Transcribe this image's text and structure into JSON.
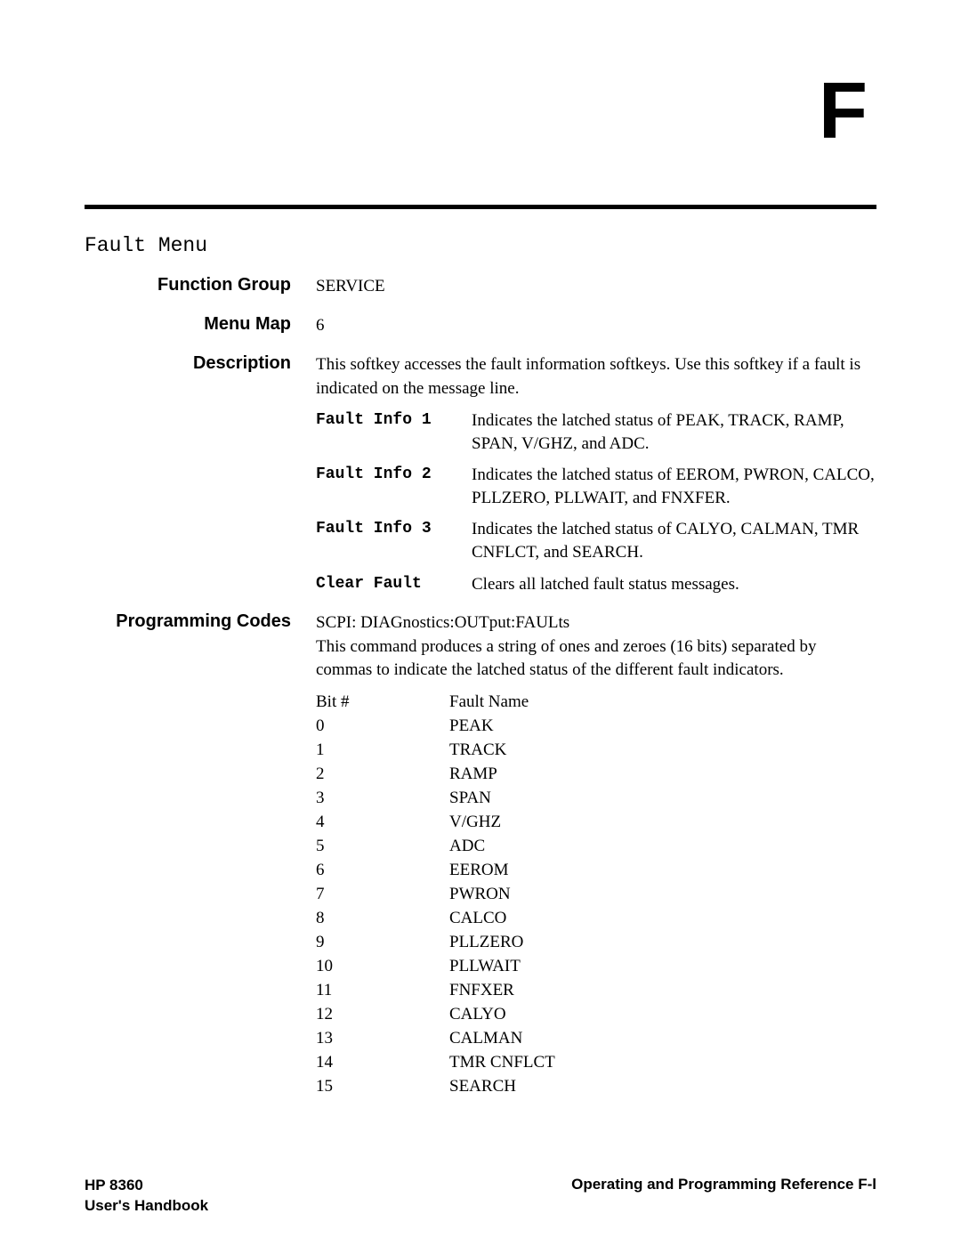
{
  "corner_letter": "F",
  "title": "Fault Menu",
  "rows": {
    "function_group": {
      "label": "Function Group",
      "value": "SERVICE"
    },
    "menu_map": {
      "label": "Menu Map",
      "value": "6"
    },
    "description": {
      "label": "Description",
      "intro": "This softkey accesses the fault information softkeys. Use this softkey if a fault is indicated on the message line.",
      "items": [
        {
          "term": "Fault Info 1",
          "def": "Indicates the latched status of PEAK, TRACK, RAMP, SPAN, V/GHZ, and ADC."
        },
        {
          "term": "Fault Info 2",
          "def": "Indicates the latched status of EEROM, PWRON, CALCO, PLLZERO, PLLWAIT, and FNXFER."
        },
        {
          "term": "Fault Info 3",
          "def": "Indicates the latched status of CALYO, CALMAN, TMR CNFLCT, and SEARCH."
        },
        {
          "term": "Clear Fault",
          "def": "Clears all latched fault status messages."
        }
      ]
    },
    "programming": {
      "label": "Programming Codes",
      "scpi": "SCPI: DIAGnostics:OUTput:FAULts",
      "body": "This command produces a string of ones and zeroes (16 bits) separated by commas to indicate the latched status of the different fault indicators.",
      "bit_header": {
        "bit": "Bit #",
        "name": "Fault Name"
      },
      "bits": [
        {
          "bit": "0",
          "name": "PEAK"
        },
        {
          "bit": "1",
          "name": "TRACK"
        },
        {
          "bit": "2",
          "name": "RAMP"
        },
        {
          "bit": "3",
          "name": "SPAN"
        },
        {
          "bit": "4",
          "name": "V/GHZ"
        },
        {
          "bit": "5",
          "name": "ADC"
        },
        {
          "bit": "6",
          "name": "EEROM"
        },
        {
          "bit": "7",
          "name": "PWRON"
        },
        {
          "bit": "8",
          "name": "CALCO"
        },
        {
          "bit": "9",
          "name": "PLLZERO"
        },
        {
          "bit": "10",
          "name": "PLLWAIT"
        },
        {
          "bit": "11",
          "name": "FNFXER"
        },
        {
          "bit": "12",
          "name": "CALYO"
        },
        {
          "bit": "13",
          "name": "CALMAN"
        },
        {
          "bit": "14",
          "name": "TMR CNFLCT"
        },
        {
          "bit": "15",
          "name": "SEARCH"
        }
      ]
    }
  },
  "footer": {
    "left_line1": "HP 8360",
    "left_line2": "User's Handbook",
    "right": "Operating and Programming Reference F-l"
  }
}
